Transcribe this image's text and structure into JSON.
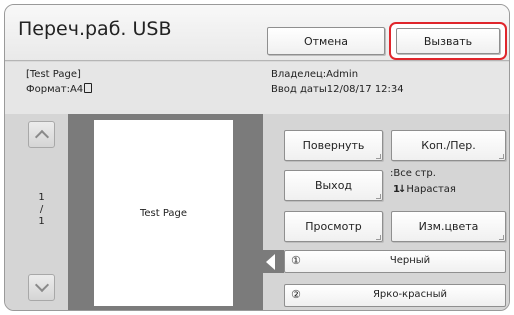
{
  "header": {
    "title": "Переч.раб. USB",
    "cancel_label": "Отмена",
    "call_label": "Вызвать"
  },
  "info": {
    "doc_name": "[Test Page]",
    "format_label": "Формат:A4",
    "owner_label": "Владелец:Admin",
    "date_label": "Ввод даты12/08/17  12:34"
  },
  "preview": {
    "page_current": "1",
    "page_sep": "/",
    "page_total": "1",
    "page_text": "Test Page"
  },
  "actions": {
    "rotate_label": "Повернуть",
    "copies_label": "Коп./Пер.",
    "exit_label": "Выход",
    "all_pages": ":Все стр.",
    "ascending": "Нарастая",
    "preview_label": "Просмотр",
    "color_label": "Изм.цвета"
  },
  "colors": [
    {
      "num": "①",
      "name": "Черный"
    },
    {
      "num": "②",
      "name": "Ярко-красный"
    }
  ],
  "style": {
    "highlight": "#e0262c",
    "preview_bg": "#7b7b7b",
    "panel_bg": "#d9d9d9"
  }
}
